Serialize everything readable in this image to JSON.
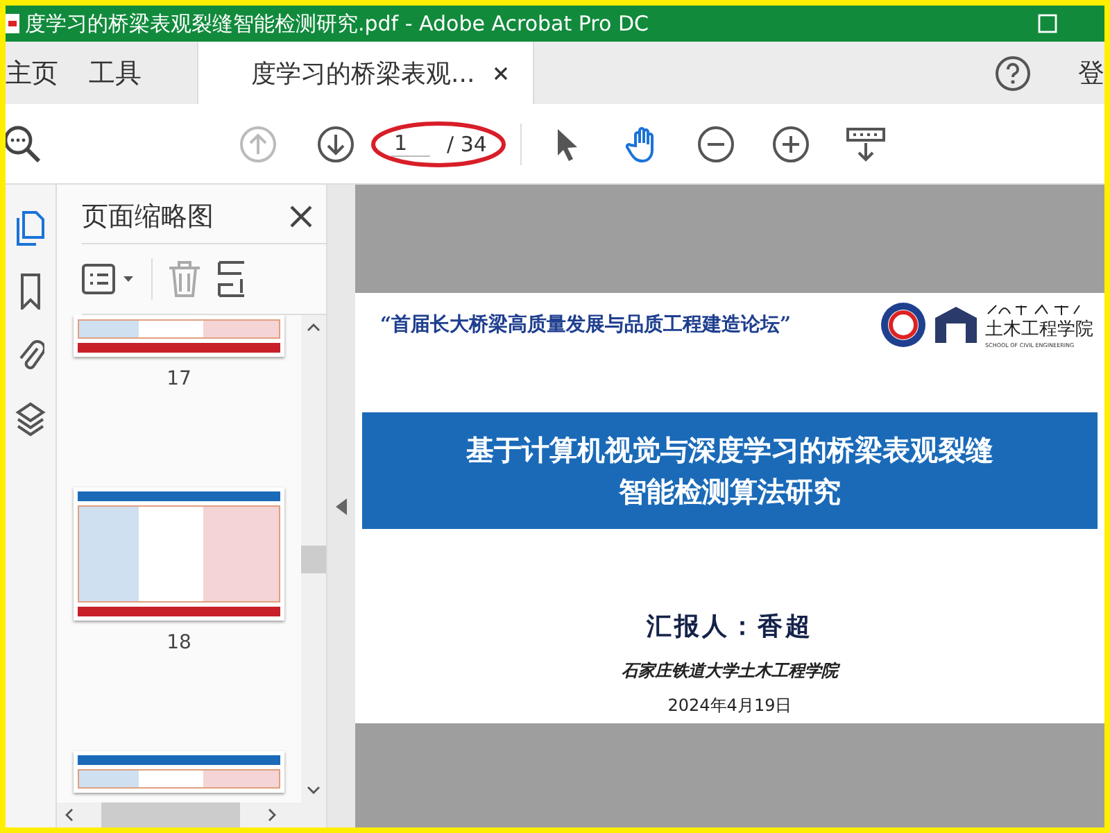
{
  "window": {
    "title": "度学习的桥梁表观裂缝智能检测研究.pdf - Adobe Acrobat Pro DC"
  },
  "tabs": [
    {
      "label": "主页",
      "selected": false,
      "closable": false
    },
    {
      "label": "工具",
      "selected": false,
      "closable": false
    },
    {
      "label": "度学习的桥梁表观...",
      "selected": true,
      "closable": true
    }
  ],
  "account": {
    "label": "登"
  },
  "toolbar": {
    "page_value": "1",
    "page_total": "/ 34",
    "prev_disabled": true
  },
  "sidebar": {
    "title": "页面缩略图",
    "thumbnails": [
      {
        "label": "17",
        "kind": "top"
      },
      {
        "label": "18",
        "kind": "full"
      },
      {
        "kind": "bottom"
      }
    ]
  },
  "slide": {
    "forum": "“首届长大桥梁高质量发展与品质工程建造论坛”",
    "logo_text": "土木工程学院",
    "logo_subtext": "SCHOOL OF CIVIL ENGINEERING",
    "title_lines": [
      "基于计算机视觉与深度学习的桥梁表观裂缝",
      "智能检测算法研究"
    ],
    "presenter": "汇报人：香超",
    "institution": "石家庄铁道大学土木工程学院",
    "date": "2024年4月19日"
  }
}
